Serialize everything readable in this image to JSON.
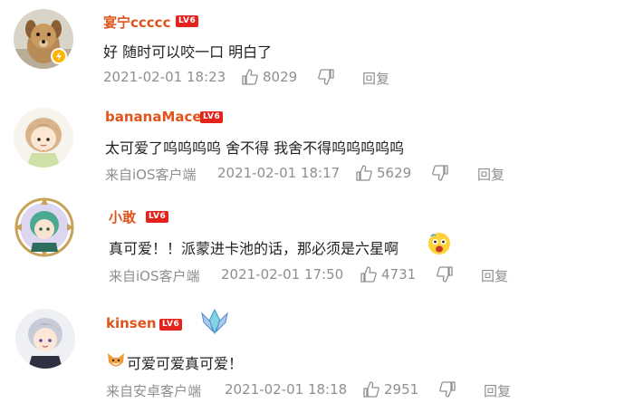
{
  "colors": {
    "username": "#e0541c",
    "level_badge": "#e5231d",
    "meta": "#8f8f8f",
    "text": "#222222"
  },
  "comments": [
    {
      "username": "宴宁ccccc",
      "level": "LV6",
      "text": "好 随时可以咬一口 明白了",
      "source": "",
      "time": "2021-02-01 18:23",
      "likes": "8029",
      "reply": "回复",
      "avatar": "dog-avatar",
      "verified": true
    },
    {
      "username": "bananaMace",
      "level": "LV6",
      "text": "太可爱了呜呜呜呜 舍不得 我舍不得呜呜呜呜呜",
      "source": "来自iOS客户端",
      "time": "2021-02-01 18:17",
      "likes": "5629",
      "reply": "回复",
      "avatar": "chibi-girl-avatar"
    },
    {
      "username": "小敢",
      "level": "LV6",
      "text": "真可爱！！派蒙进卡池的话，那必须是六星啊",
      "source": "来自iOS客户端",
      "time": "2021-02-01 17:50",
      "likes": "4731",
      "reply": "回复",
      "avatar": "anime-character-avatar",
      "emoji": "shocked-face-emoji"
    },
    {
      "username": "kinsen",
      "level": "LV6",
      "text": "可爱可爱真可爱！",
      "source": "来自安卓客户端",
      "time": "2021-02-01 18:18",
      "likes": "2951",
      "reply": "回复",
      "avatar": "anime-boy-avatar",
      "emoji": "fox-emoji",
      "badge": "crystal-badge-icon"
    }
  ]
}
